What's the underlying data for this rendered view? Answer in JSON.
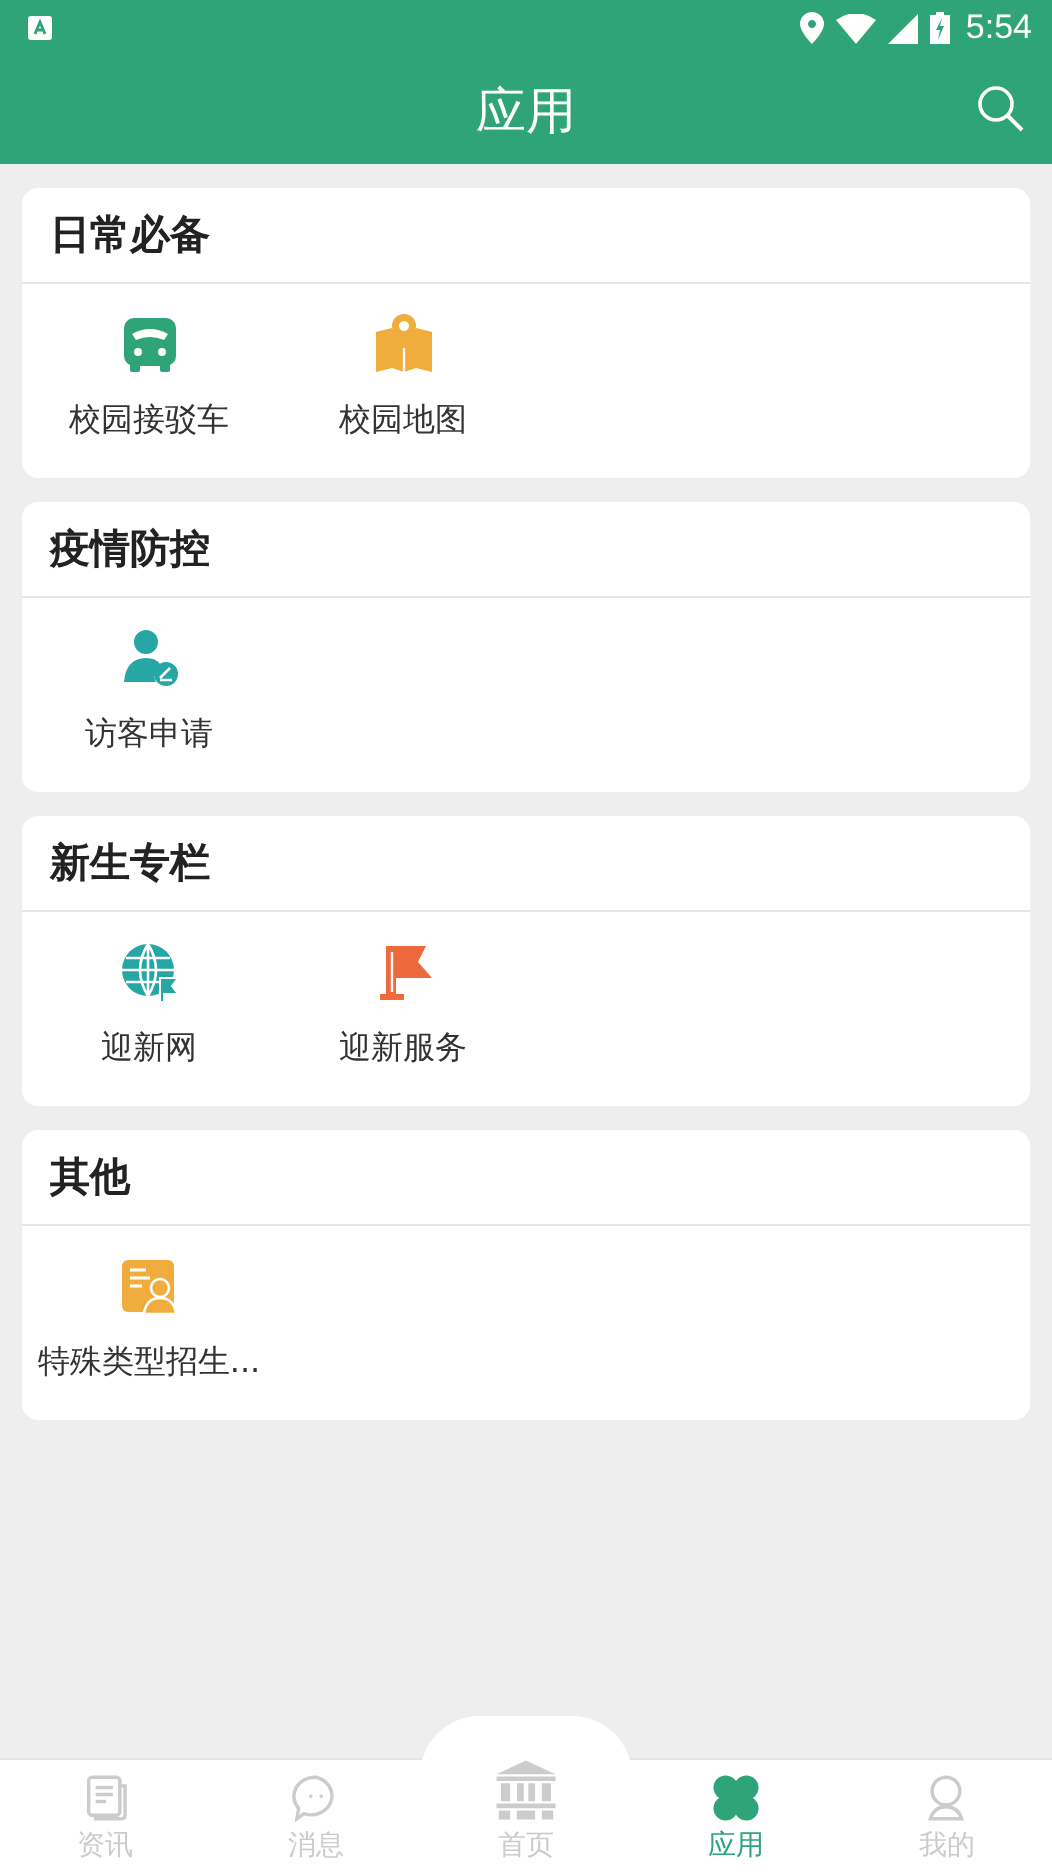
{
  "status_bar": {
    "time": "5:54"
  },
  "app_bar": {
    "title": "应用"
  },
  "sections": [
    {
      "title": "日常必备",
      "items": [
        {
          "label": "校园接驳车"
        },
        {
          "label": "校园地图"
        }
      ]
    },
    {
      "title": "疫情防控",
      "items": [
        {
          "label": "访客申请"
        }
      ]
    },
    {
      "title": "新生专栏",
      "items": [
        {
          "label": "迎新网"
        },
        {
          "label": "迎新服务"
        }
      ]
    },
    {
      "title": "其他",
      "items": [
        {
          "label": "特殊类型招生..."
        }
      ]
    }
  ],
  "tabs": [
    {
      "label": "资讯",
      "selected": false
    },
    {
      "label": "消息",
      "selected": false
    },
    {
      "label": "首页",
      "selected": false
    },
    {
      "label": "应用",
      "selected": true
    },
    {
      "label": "我的",
      "selected": false
    }
  ]
}
